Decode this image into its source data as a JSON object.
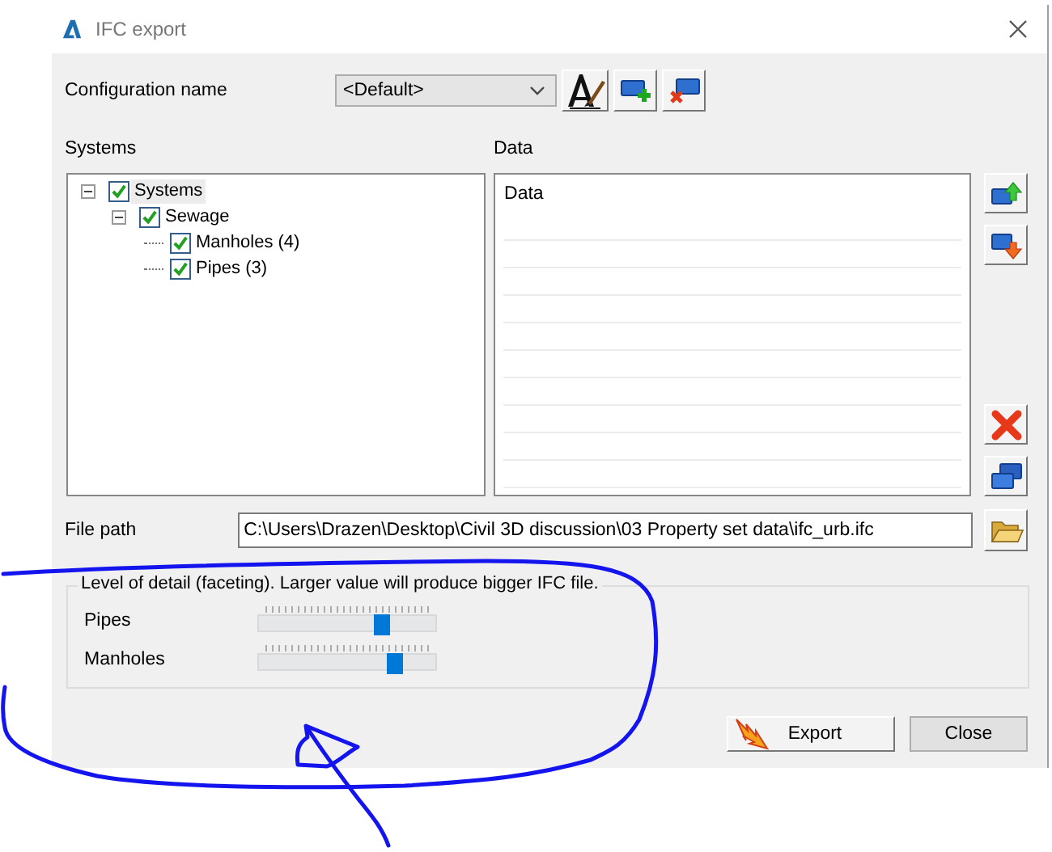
{
  "window": {
    "title": "IFC export"
  },
  "configuration": {
    "label": "Configuration name",
    "value": "<Default>"
  },
  "systems": {
    "label": "Systems",
    "tree": [
      {
        "label": "Systems",
        "checked": true,
        "expanded": true,
        "selected": true,
        "children": [
          {
            "label": "Sewage",
            "checked": true,
            "expanded": true,
            "selected": false,
            "children": [
              {
                "label": "Manholes (4)",
                "checked": true,
                "selected": false
              },
              {
                "label": "Pipes (3)",
                "checked": true,
                "selected": false
              }
            ]
          }
        ]
      }
    ]
  },
  "data": {
    "label": "Data",
    "header": "Data"
  },
  "file_path": {
    "label": "File path",
    "value": "C:\\Users\\Drazen\\Desktop\\Civil 3D discussion\\03 Property set data\\ifc_urb.ifc"
  },
  "level_of_detail": {
    "legend": "Level of detail (faceting). Larger value will produce bigger IFC file.",
    "sliders": [
      {
        "label": "Pipes",
        "level": 0.7
      },
      {
        "label": "Manholes",
        "level": 0.77
      }
    ]
  },
  "buttons": [
    {
      "label": "Export",
      "kind": "export"
    },
    {
      "label": "Close",
      "kind": "plain"
    }
  ]
}
